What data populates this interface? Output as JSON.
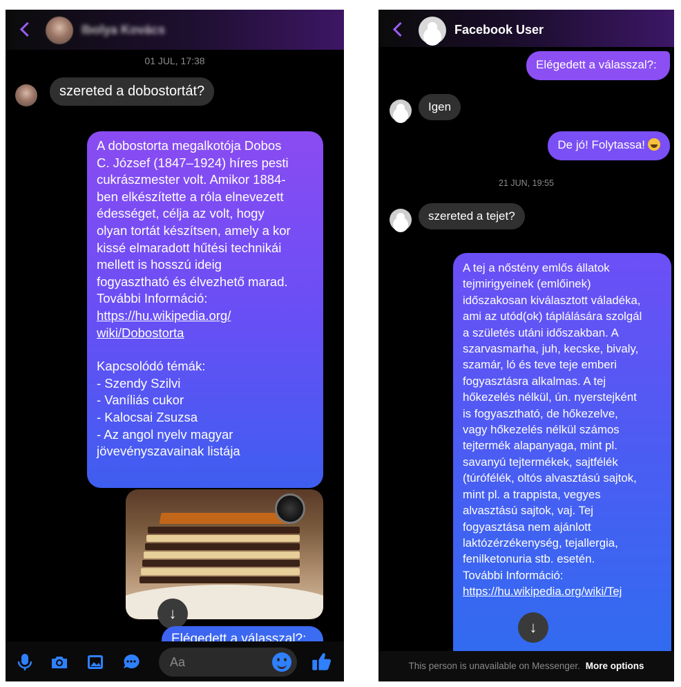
{
  "left": {
    "header": {
      "name": "Ibolya Kovács"
    },
    "timestamp": "01 JUL, 17:38",
    "incoming_message": "szereted a dobostortát?",
    "outgoing_lines": [
      "A dobostorta megalkotója Dobos",
      "C. József (1847–1924) híres pesti",
      "cukrászmester volt. Amikor 1884-",
      "ben elkészítette a róla elnevezett",
      "édességet, célja az volt, hogy",
      "olyan tortát készítsen, amely a kor",
      "kissé elmaradott hűtési technikái",
      "mellett is hosszú ideig",
      "fogyasztható és élvezhető marad.",
      "További Információ:"
    ],
    "link_lines": [
      "https://hu.wikipedia.org/",
      "wiki/Dobostorta"
    ],
    "related_lines": [
      "Kapcsolódó témák:",
      "- Szendy Szilvi",
      "- Vaníliás cukor",
      "- Kalocsai Zsuzsa",
      "- Az angol nyelv magyar",
      "jövevényszavainak listája"
    ],
    "last_message": "Elégedett a válasszal?:",
    "composer": {
      "placeholder": "Aa"
    },
    "icons": [
      "mic-icon",
      "camera-icon",
      "gallery-icon",
      "chat-bubble-icon",
      "emoji-icon",
      "thumbs-up-icon"
    ],
    "accent": "#2f80ff"
  },
  "right": {
    "header": {
      "name": "Facebook User"
    },
    "top_message": "Elégedett a válasszal?:",
    "incoming_reply": "Igen",
    "outgoing_reply": "De jó! Folytassa!",
    "timestamp": "21 JUN, 19:55",
    "incoming_question": "szereted a tejet?",
    "outgoing_lines": [
      "A tej a nőstény emlős állatok",
      "tejmirigyeinek (emlőinek)",
      "időszakosan kiválasztott váladéka,",
      "ami az utód(ok) táplálására szolgál",
      "a születés utáni időszakban. A",
      "szarvasmarha, juh, kecske, bivaly,",
      "szamár, ló és teve teje emberi",
      "fogyasztásra alkalmas. A tej",
      "hőkezelés nélkül, ún. nyerstejként",
      "is fogyasztható, de hőkezelve,",
      "vagy hőkezelés nélkül számos",
      "tejtermék alapanyaga, mint pl.",
      "savanyú tejtermékek, sajtfélék",
      "(túrófélék, oltós alvasztású sajtok,",
      "mint pl. a trappista, vegyes",
      "alvasztású sajtok, vaj. Tej",
      "fogyasztása nem ajánlott",
      "laktózérzékenység, tejallergia,",
      "fenilketonuria stb. esetén.",
      "További Információ:"
    ],
    "link": "https://hu.wikipedia.org/wiki/Tej",
    "footer": {
      "text": "This person is unavailable on Messenger.",
      "more": "More options"
    }
  }
}
